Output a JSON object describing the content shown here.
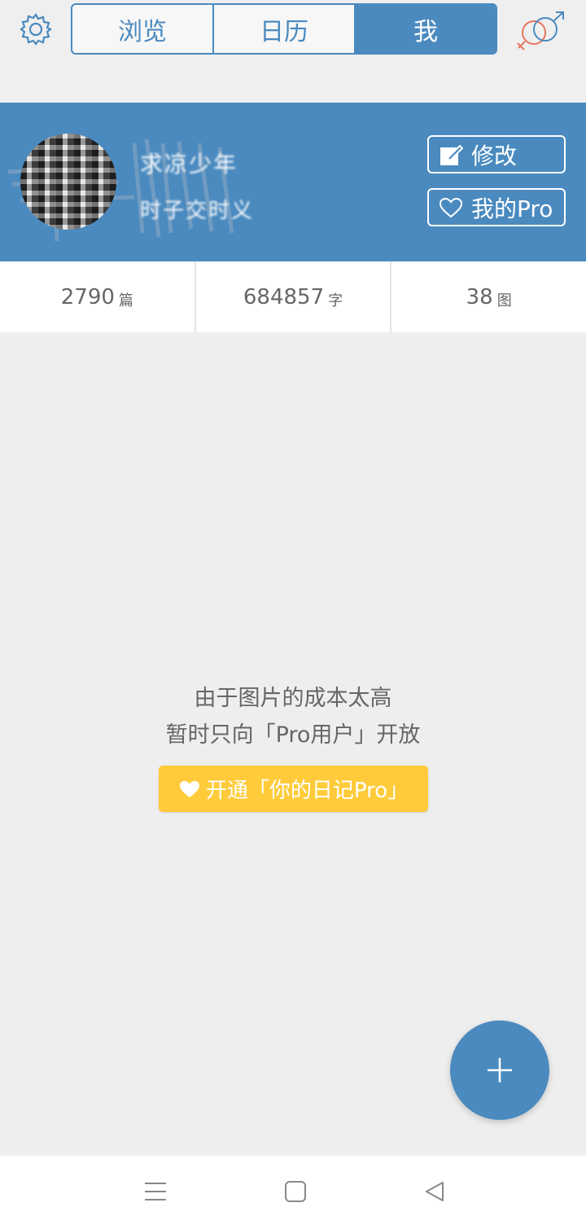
{
  "tabs": [
    {
      "label": "浏览"
    },
    {
      "label": "日历"
    },
    {
      "label": "我"
    }
  ],
  "profile": {
    "username": "求凉少年",
    "subtitle": "时子交时义",
    "edit_label": "修改",
    "pro_label": "我的Pro"
  },
  "stats": [
    {
      "value": "2790",
      "unit": "篇"
    },
    {
      "value": "684857",
      "unit": "字"
    },
    {
      "value": "38",
      "unit": "图"
    }
  ],
  "message": {
    "line1": "由于图片的成本太高",
    "line2": "暂时只向「Pro用户」开放",
    "button": "开通「你的日记Pro」"
  },
  "colors": {
    "accent": "#4a8abf",
    "pro_yellow": "#ffcb3a",
    "gender_female": "#e9745f",
    "gender_male": "#4a8abf"
  },
  "icons": [
    "settings-gear-icon",
    "gender-icon",
    "edit-icon",
    "heart-icon",
    "plus-icon",
    "menu-icon",
    "home-icon",
    "back-icon"
  ]
}
